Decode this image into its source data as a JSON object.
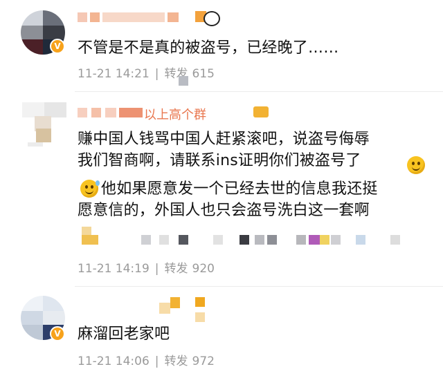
{
  "comments": [
    {
      "text": "不管是不是真的被盗号，已经晚了……",
      "time": "11-21 14:21",
      "repost_label": "转发",
      "repost_count": "615"
    },
    {
      "username_visible": "以上高个群",
      "text": "赚中国人钱骂中国人赶紧滚吧，说盗号侮辱\n我们智商啊，请联系ins证明你们被盗号了",
      "text2": "他如果愿意发一个已经去世的信息我还挺\n愿意信的，外国人也只会盗号洗白这一套啊",
      "time": "11-21 14:19",
      "repost_label": "转发",
      "repost_count": "920"
    },
    {
      "text": "麻溜回老家吧",
      "time": "11-21 14:06",
      "repost_label": "转发",
      "repost_count": "972"
    }
  ],
  "icons": {
    "verified_badge": "v-badge-icon",
    "smile_emoji": "smile-emoji-icon",
    "sweat_emoji": "sweat-smile-emoji-icon",
    "crown": "crown-icon",
    "panda": "panda-icon"
  },
  "colors": {
    "badge": "#f7a21b",
    "meta": "#9a9a9a",
    "text": "#111111"
  }
}
